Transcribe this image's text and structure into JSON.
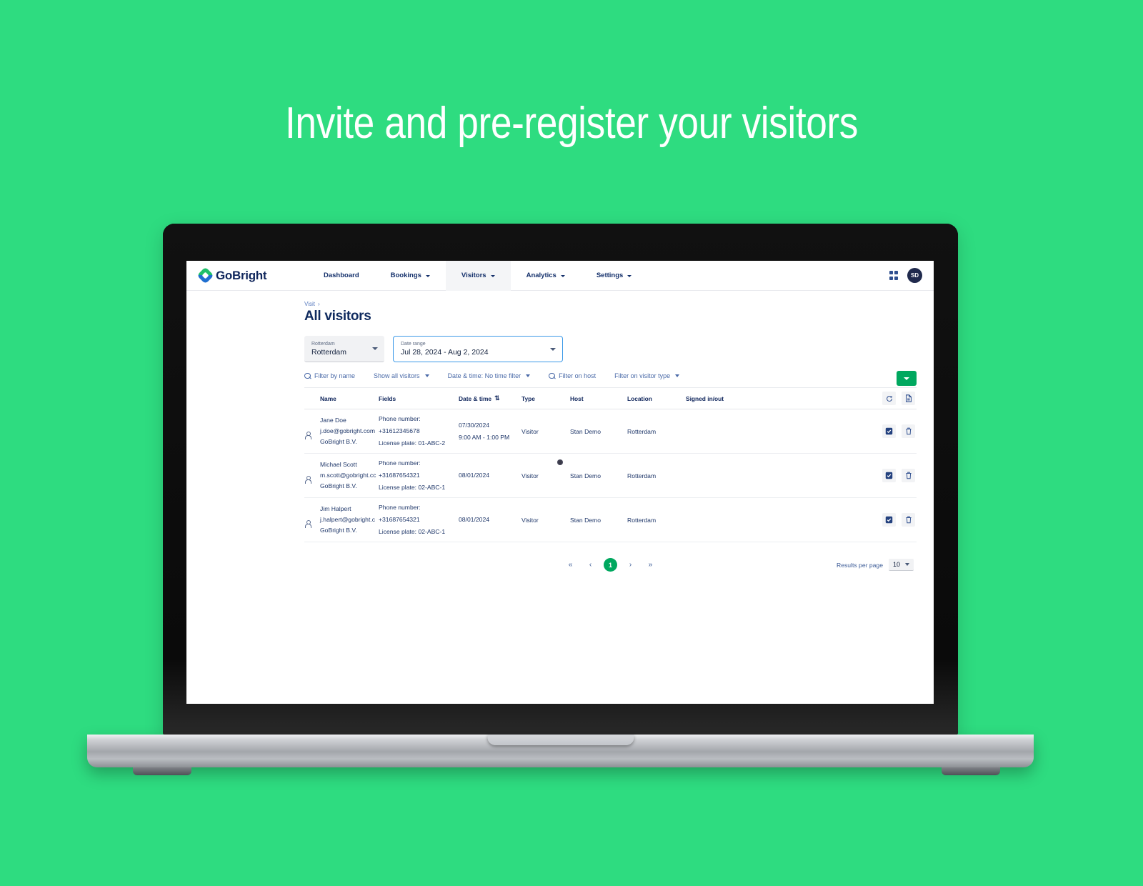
{
  "hero": {
    "headline": "Invite and pre-register your visitors"
  },
  "app": {
    "logo_text": "GoBright",
    "nav": [
      {
        "label": "Dashboard",
        "has_caret": false,
        "active": false
      },
      {
        "label": "Bookings",
        "has_caret": true,
        "active": false
      },
      {
        "label": "Visitors",
        "has_caret": true,
        "active": true
      },
      {
        "label": "Analytics",
        "has_caret": true,
        "active": false
      },
      {
        "label": "Settings",
        "has_caret": true,
        "active": false
      }
    ],
    "avatar_initials": "SD"
  },
  "page": {
    "breadcrumb": "Visit",
    "breadcrumb_arrow": "›",
    "title": "All visitors"
  },
  "filters": {
    "location": {
      "label": "Rotterdam",
      "value": "Rotterdam"
    },
    "date_range": {
      "label": "Date range",
      "value": "Jul 28, 2024 - Aug 2, 2024"
    },
    "name_filter": "Filter by name",
    "show_all": "Show all visitors",
    "datetime_filter": "Date & time: No time filter",
    "host_filter": "Filter on host",
    "visitor_type_filter": "Filter on visitor type"
  },
  "table": {
    "headers": {
      "name": "Name",
      "fields": "Fields",
      "datetime": "Date & time",
      "sort": "⇅",
      "type": "Type",
      "host": "Host",
      "location": "Location",
      "signed": "Signed in/out"
    },
    "rows": [
      {
        "name": "Jane Doe",
        "email": "j.doe@gobright.com",
        "company": "GoBright B.V.",
        "phone": "Phone number: +31612345678",
        "plate": "License plate: 01-ABC-2",
        "date": "07/30/2024",
        "time": "9:00 AM - 1:00 PM",
        "type": "Visitor",
        "host": "Stan Demo",
        "location": "Rotterdam"
      },
      {
        "name": "Michael Scott",
        "email": "m.scott@gobright.cc",
        "company": "GoBright B.V.",
        "phone": "Phone number: +31687654321",
        "plate": "License plate: 02-ABC-1",
        "date": "08/01/2024",
        "time": "",
        "type": "Visitor",
        "host": "Stan Demo",
        "location": "Rotterdam"
      },
      {
        "name": "Jim Halpert",
        "email": "j.halpert@gobright.c",
        "company": "GoBright B.V.",
        "phone": "Phone number: +31687654321",
        "plate": "License plate: 02-ABC-1",
        "date": "08/01/2024",
        "time": "",
        "type": "Visitor",
        "host": "Stan Demo",
        "location": "Rotterdam"
      }
    ]
  },
  "pagination": {
    "first": "«",
    "prev": "‹",
    "current": "1",
    "next": "›",
    "last": "»",
    "results_label": "Results per page",
    "results_value": "10"
  },
  "colors": {
    "background_green": "#2edc80",
    "accent_green": "#00a85f",
    "brand_navy": "#10265c",
    "focus_blue": "#3d9ae8"
  }
}
